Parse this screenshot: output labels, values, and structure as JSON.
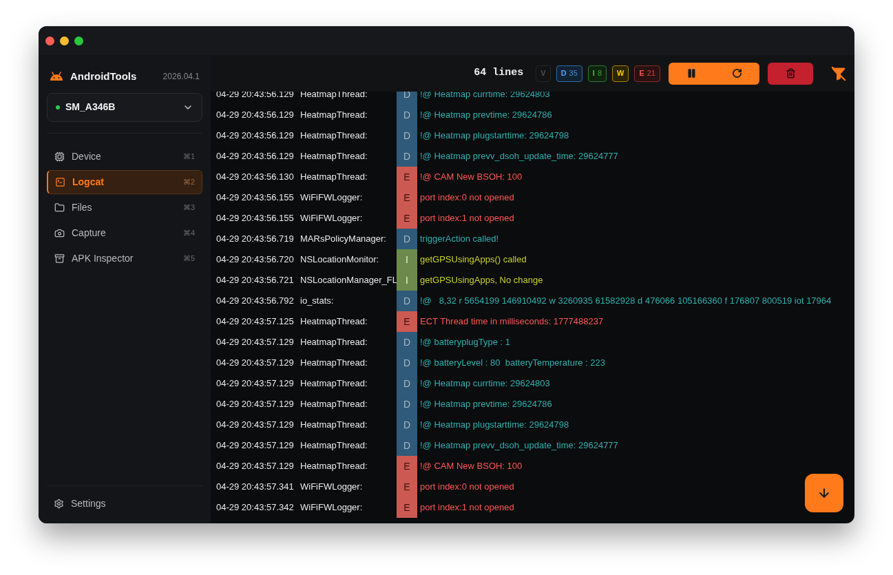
{
  "app": {
    "name": "AndroidTools",
    "version": "2026.04.1"
  },
  "device": {
    "name": "SM_A346B",
    "connected": true
  },
  "nav": [
    {
      "label": "Device",
      "shortcut": "⌘1",
      "selected": false
    },
    {
      "label": "Logcat",
      "shortcut": "⌘2",
      "selected": true
    },
    {
      "label": "Files",
      "shortcut": "⌘3",
      "selected": false
    },
    {
      "label": "Capture",
      "shortcut": "⌘4",
      "selected": false
    },
    {
      "label": "APK Inspector",
      "shortcut": "⌘5",
      "selected": false
    }
  ],
  "settings": {
    "label": "Settings"
  },
  "toolbar": {
    "line_count": "64 lines",
    "filters": [
      {
        "kind": "verbose",
        "label": "V",
        "selected": false
      },
      {
        "kind": "debug",
        "label": "D",
        "count": "35",
        "selected": true
      },
      {
        "kind": "info",
        "label": "I",
        "count": "8",
        "selected": true
      },
      {
        "kind": "warn",
        "label": "W",
        "selected": true
      },
      {
        "kind": "error",
        "label": "E",
        "count": "21",
        "selected": true
      }
    ],
    "paused": false
  },
  "logs": [
    {
      "time": "04-29 20:43:56.129",
      "tag": "HeatmapThread:",
      "kind": "debug",
      "level": "D",
      "message": "!@ Heatmap currtime: 29624803"
    },
    {
      "time": "04-29 20:43:56.129",
      "tag": "HeatmapThread:",
      "kind": "debug",
      "level": "D",
      "message": "!@ Heatmap prevtime: 29624786"
    },
    {
      "time": "04-29 20:43:56.129",
      "tag": "HeatmapThread:",
      "kind": "debug",
      "level": "D",
      "message": "!@ Heatmap plugstarttime: 29624798"
    },
    {
      "time": "04-29 20:43:56.129",
      "tag": "HeatmapThread:",
      "kind": "debug",
      "level": "D",
      "message": "!@ Heatmap prevv_dsoh_update_time: 29624777"
    },
    {
      "time": "04-29 20:43:56.130",
      "tag": "HeatmapThread:",
      "kind": "error",
      "level": "E",
      "message": "!@ CAM New BSOH: 100"
    },
    {
      "time": "04-29 20:43:56.155",
      "tag": "WiFiFWLogger:",
      "kind": "error",
      "level": "E",
      "message": "port index:0 not opened"
    },
    {
      "time": "04-29 20:43:56.155",
      "tag": "WiFiFWLogger:",
      "kind": "error",
      "level": "E",
      "message": "port index:1 not opened"
    },
    {
      "time": "04-29 20:43:56.719",
      "tag": "MARsPolicyManager:",
      "kind": "debug",
      "level": "D",
      "message": "triggerAction called!"
    },
    {
      "time": "04-29 20:43:56.720",
      "tag": "NSLocationMonitor:",
      "kind": "info",
      "level": "I",
      "message": "getGPSUsingApps() called"
    },
    {
      "time": "04-29 20:43:56.721",
      "tag": "NSLocationManager_FL",
      "kind": "info",
      "level": "I",
      "message": "getGPSUsingApps, No change"
    },
    {
      "time": "04-29 20:43:56.792",
      "tag": "io_stats:",
      "kind": "debug",
      "level": "D",
      "message": "!@   8,32 r 5654199 146910492 w 3260935 61582928 d 476066 105166360 f 176807 800519 iot 17964"
    },
    {
      "time": "04-29 20:43:57.125",
      "tag": "HeatmapThread:",
      "kind": "error",
      "level": "E",
      "message": "ECT Thread time in milliseconds: 1777488237"
    },
    {
      "time": "04-29 20:43:57.129",
      "tag": "HeatmapThread:",
      "kind": "debug",
      "level": "D",
      "message": "!@ batteryplugType : 1"
    },
    {
      "time": "04-29 20:43:57.129",
      "tag": "HeatmapThread:",
      "kind": "debug",
      "level": "D",
      "message": "!@ batteryLevel : 80  batteryTemperature : 223"
    },
    {
      "time": "04-29 20:43:57.129",
      "tag": "HeatmapThread:",
      "kind": "debug",
      "level": "D",
      "message": "!@ Heatmap currtime: 29624803"
    },
    {
      "time": "04-29 20:43:57.129",
      "tag": "HeatmapThread:",
      "kind": "debug",
      "level": "D",
      "message": "!@ Heatmap prevtime: 29624786"
    },
    {
      "time": "04-29 20:43:57.129",
      "tag": "HeatmapThread:",
      "kind": "debug",
      "level": "D",
      "message": "!@ Heatmap plugstarttime: 29624798"
    },
    {
      "time": "04-29 20:43:57.129",
      "tag": "HeatmapThread:",
      "kind": "debug",
      "level": "D",
      "message": "!@ Heatmap prevv_dsoh_update_time: 29624777"
    },
    {
      "time": "04-29 20:43:57.129",
      "tag": "HeatmapThread:",
      "kind": "error",
      "level": "E",
      "message": "!@ CAM New BSOH: 100"
    },
    {
      "time": "04-29 20:43:57.341",
      "tag": "WiFiFWLogger:",
      "kind": "error",
      "level": "E",
      "message": "port index:0 not opened"
    },
    {
      "time": "04-29 20:43:57.342",
      "tag": "WiFiFWLogger:",
      "kind": "error",
      "level": "E",
      "message": "port index:1 not opened"
    }
  ]
}
